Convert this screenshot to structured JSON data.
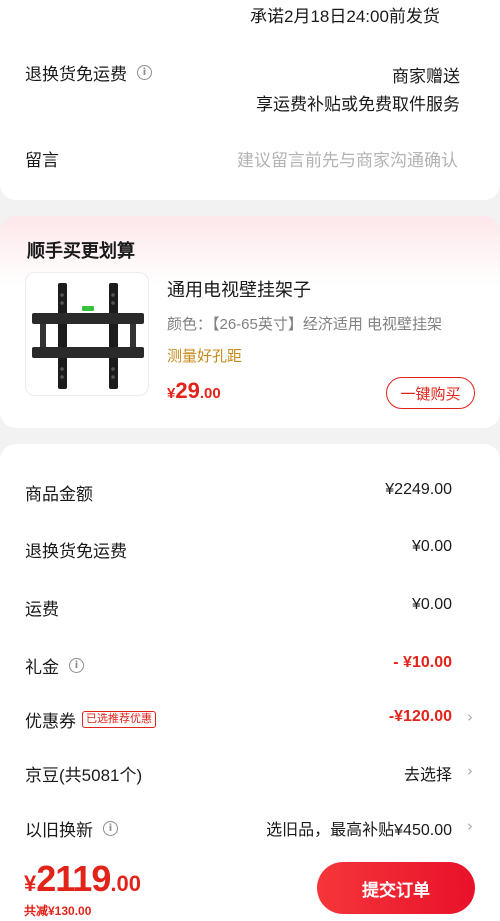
{
  "delivery": {
    "promise": "承诺2月18日24:00前发货",
    "return_shipping": {
      "label": "退换货免运费",
      "value_line1": "商家赠送",
      "value_line2": "享运费补贴或免费取件服务"
    },
    "message": {
      "label": "留言",
      "placeholder": "建议留言前先与商家沟通确认"
    }
  },
  "bundle": {
    "title": "顺手买更划算",
    "product": {
      "image_icon": "tv-wall-mount-image",
      "name": "通用电视壁挂架子",
      "spec": "颜色：【26-65英寸】经济适用 电视壁挂架",
      "note": "测量好孔距",
      "price_currency": "¥",
      "price_integer": "29",
      "price_decimal": ".00",
      "buy_label": "一键购买"
    }
  },
  "summary": {
    "rows": [
      {
        "label": "商品金额",
        "value": "¥2249.00"
      },
      {
        "label": "退换货免运费",
        "value": "¥0.00"
      },
      {
        "label": "运费",
        "value": "¥0.00"
      },
      {
        "label": "礼金",
        "value": "- ¥10.00"
      },
      {
        "label": "优惠券",
        "tag": "已选推荐优惠",
        "value": "-¥120.00"
      },
      {
        "label": "京豆(共5081个)",
        "value": "去选择"
      },
      {
        "label": "以旧换新",
        "value": "选旧品，最高补贴¥450.00"
      }
    ]
  },
  "footer": {
    "total_currency": "¥",
    "total_integer": "2119",
    "total_decimal": ".00",
    "discount": "共减¥130.00",
    "submit_label": "提交订单"
  },
  "colors": {
    "accent": "#e2231a",
    "note": "#c88a1a",
    "muted": "#808080"
  }
}
